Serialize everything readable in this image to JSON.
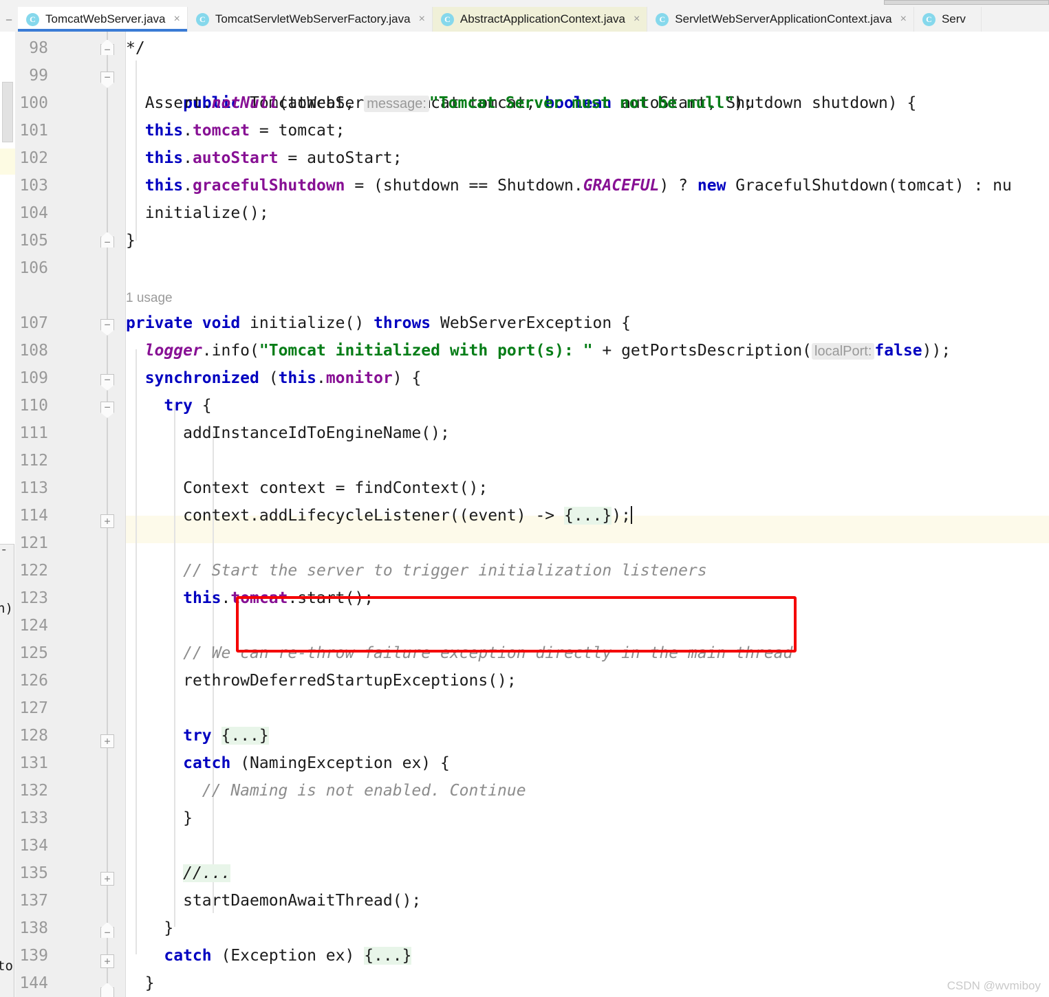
{
  "window": {
    "left_dash_glyph": "–",
    "watermark": "CSDN @wvmiboy"
  },
  "tabs": [
    {
      "label": "TomcatWebServer.java",
      "icon": "C",
      "close": "×",
      "state": "active"
    },
    {
      "label": "TomcatServletWebServerFactory.java",
      "icon": "C",
      "close": "×",
      "state": "plain"
    },
    {
      "label": "AbstractApplicationContext.java",
      "icon": "C",
      "close": "×",
      "state": "context"
    },
    {
      "label": "ServletWebServerApplicationContext.java",
      "icon": "C",
      "close": "×",
      "state": "plain"
    },
    {
      "label": "Serv",
      "icon": "C",
      "close": "",
      "state": "plain"
    }
  ],
  "gutter": {
    "line_numbers": [
      "98",
      "99",
      "100",
      "101",
      "102",
      "103",
      "104",
      "105",
      "106",
      "107",
      "108",
      "109",
      "110",
      "111",
      "112",
      "113",
      "114",
      "121",
      "122",
      "123",
      "124",
      "125",
      "126",
      "127",
      "128",
      "131",
      "132",
      "133",
      "134",
      "135",
      "137",
      "138",
      "139",
      "144"
    ],
    "fold_markers": [
      {
        "line": "98",
        "glyph": "−",
        "type": "end"
      },
      {
        "line": "99",
        "glyph": "−",
        "type": "start"
      },
      {
        "line": "105",
        "glyph": "−",
        "type": "end"
      },
      {
        "line": "107",
        "glyph": "−",
        "type": "start"
      },
      {
        "line": "109",
        "glyph": "−",
        "type": "start"
      },
      {
        "line": "110",
        "glyph": "−",
        "type": "start"
      },
      {
        "line": "114",
        "glyph": "+",
        "type": "collapsed"
      },
      {
        "line": "128",
        "glyph": "+",
        "type": "collapsed"
      },
      {
        "line": "135",
        "glyph": "+",
        "type": "collapsed"
      },
      {
        "line": "138",
        "glyph": "−",
        "type": "end"
      },
      {
        "line": "139",
        "glyph": "+",
        "type": "collapsed"
      }
    ]
  },
  "code": {
    "usage_hint": "1 usage",
    "lines": {
      "l98": "*/",
      "l99": {
        "kw1": "public",
        "rest": " TomcatWebServer(Tomcat tomcat, ",
        "kw2": "boolean",
        "rest2": " autoStart, Shutdown shutdown) {"
      },
      "l100": {
        "pre": "Assert.",
        "stat": "notNull",
        "mid": "(tomcat, ",
        "hint": "message:",
        "str": "\"Tomcat Server must not be null\"",
        "post": ");"
      },
      "l101": {
        "kw": "this",
        "dot": ".",
        "fld": "tomcat",
        "post": " = tomcat;"
      },
      "l102": {
        "kw": "this",
        "dot": ".",
        "fld": "autoStart",
        "post": " = autoStart;"
      },
      "l103": {
        "kw": "this",
        "dot": ".",
        "fld": "gracefulShutdown",
        "mid": " = (shutdown == Shutdown.",
        "stat": "GRACEFUL",
        "mid2": ") ? ",
        "kw2": "new",
        "post": " GracefulShutdown(tomcat) : nu"
      },
      "l104": "initialize();",
      "l105": "}",
      "l107": {
        "kw1": "private",
        "kw2": "void",
        "name": " initialize() ",
        "kw3": "throws",
        "post": " WebServerException {"
      },
      "l108": {
        "stat": "logger",
        "mid": ".info(",
        "str": "\"Tomcat initialized with port(s): \"",
        "mid2": " + getPortsDescription(",
        "hint": "localPort:",
        "kw": "false",
        "post": "));"
      },
      "l109": {
        "kw1": "synchronized",
        "mid": " (",
        "kw2": "this",
        "dot": ".",
        "fld": "monitor",
        "post": ") {"
      },
      "l110": {
        "kw": "try",
        "post": " {"
      },
      "l111": "addInstanceIdToEngineName();",
      "l113": "Context context = findContext();",
      "l114": {
        "pre": "context.addLifecycleListener((event) -> ",
        "fold": "{...}",
        "post": ");"
      },
      "l122": "// Start the server to trigger initialization listeners",
      "l123": {
        "kw": "this",
        "dot": ".",
        "fld": "tomcat",
        "post": ".start();"
      },
      "l125": "// We can re-throw failure exception directly in the main thread",
      "l126": "rethrowDeferredStartupExceptions();",
      "l128": {
        "kw": "try",
        "sp": " ",
        "fold": "{...}"
      },
      "l131": {
        "kw": "catch",
        "post": " (NamingException ex) {"
      },
      "l132": "// Naming is not enabled. Continue",
      "l133": "}",
      "l135": "//...",
      "l137": "startDaemonAwaitThread();",
      "l138": "}",
      "l139": {
        "kw": "catch",
        "mid": " (Exception ex) ",
        "fold": "{...}"
      },
      "l144": "}"
    }
  },
  "sliver": {
    "text_a": "n)",
    "text_b": "to"
  },
  "colors": {
    "accent_tab": "#3a7bd5",
    "annotation_box": "#f40000",
    "keyword": "#0000c0",
    "string": "#067d17",
    "field": "#871094",
    "comment": "#8c8c8c",
    "caret_line": "#fdfaea",
    "fold_placeholder_bg": "#e8f5e9"
  }
}
